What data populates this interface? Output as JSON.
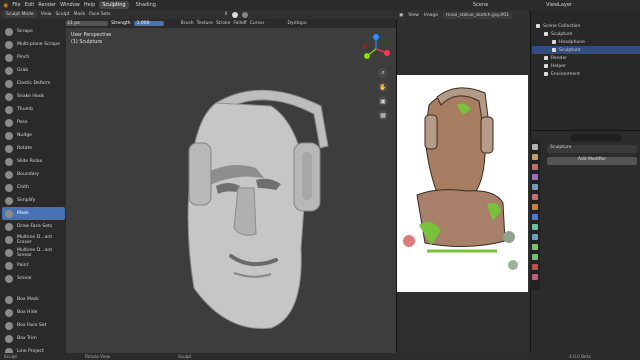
{
  "topbar": {
    "menus": [
      "File",
      "Edit",
      "Render",
      "Window",
      "Help"
    ],
    "workspace_tabs": [
      "Sculpting",
      "Shading"
    ],
    "active_workspace": "Sculpting",
    "scene": "Scene",
    "view_layer": "ViewLayer"
  },
  "viewport_header": {
    "mode": "Sculpt Mode",
    "menus": [
      "View",
      "Sculpt",
      "Mask",
      "Face Sets"
    ],
    "orientation": "X",
    "shading": "Dyntopo"
  },
  "tool_header": {
    "brush_name": "Mask",
    "radius_label": "Radius",
    "radius_value": "21 px",
    "strength_label": "Strength",
    "strength_value": "1.000",
    "menus": [
      "Brush",
      "Texture",
      "Stroke",
      "Falloff",
      "Cursor"
    ]
  },
  "toolbar": {
    "tools": [
      {
        "label": "Scrape",
        "active": false
      },
      {
        "label": "Multi-plane Scrape",
        "active": false
      },
      {
        "label": "Pinch",
        "active": false
      },
      {
        "label": "Grab",
        "active": false
      },
      {
        "label": "Elastic Deform",
        "active": false
      },
      {
        "label": "Snake Hook",
        "active": false
      },
      {
        "label": "Thumb",
        "active": false
      },
      {
        "label": "Pose",
        "active": false
      },
      {
        "label": "Nudge",
        "active": false
      },
      {
        "label": "Rotate",
        "active": false
      },
      {
        "label": "Slide Relax",
        "active": false
      },
      {
        "label": "Boundary",
        "active": false
      },
      {
        "label": "Cloth",
        "active": false
      },
      {
        "label": "Simplify",
        "active": false
      },
      {
        "label": "Mask",
        "active": true
      },
      {
        "label": "Draw Face Sets",
        "active": false
      },
      {
        "label": "Multires D...ant Eraser",
        "active": false
      },
      {
        "label": "Multires D...ant Smear",
        "active": false
      },
      {
        "label": "Paint",
        "active": false
      },
      {
        "label": "Smear",
        "active": false
      },
      {
        "label": "Box Mask",
        "active": false
      },
      {
        "label": "Box Hide",
        "active": false
      },
      {
        "label": "Box Face Set",
        "active": false
      },
      {
        "label": "Box Trim",
        "active": false
      },
      {
        "label": "Line Project",
        "active": false
      }
    ]
  },
  "viewport": {
    "perspective": "User Perspective",
    "object": "(1) Sculpture"
  },
  "image_editor": {
    "menus": [
      "View",
      "Image"
    ],
    "filename": "moai_statue_sketch.jpg.001"
  },
  "outliner": {
    "rows": [
      {
        "label": "Scene Collection",
        "indent": 0,
        "selected": false
      },
      {
        "label": "Sculpture",
        "indent": 1,
        "selected": false
      },
      {
        "label": "Headphone",
        "indent": 2,
        "selected": false
      },
      {
        "label": "Sculpture",
        "indent": 2,
        "selected": true
      },
      {
        "label": "Render",
        "indent": 1,
        "selected": false
      },
      {
        "label": "Helper",
        "indent": 1,
        "selected": false
      },
      {
        "label": "Environment",
        "indent": 1,
        "selected": false
      }
    ]
  },
  "properties": {
    "object_name": "Sculpture",
    "add_modifier": "Add Modifier"
  },
  "statusbar": {
    "items": [
      "Sculpt",
      "Rotate View",
      "Sculpt"
    ],
    "version": "4.0.0 Beta"
  },
  "colors": {
    "accent": "#4772b3",
    "selected_row": "#334d80",
    "viewport_bg": "#3d3d3d"
  }
}
